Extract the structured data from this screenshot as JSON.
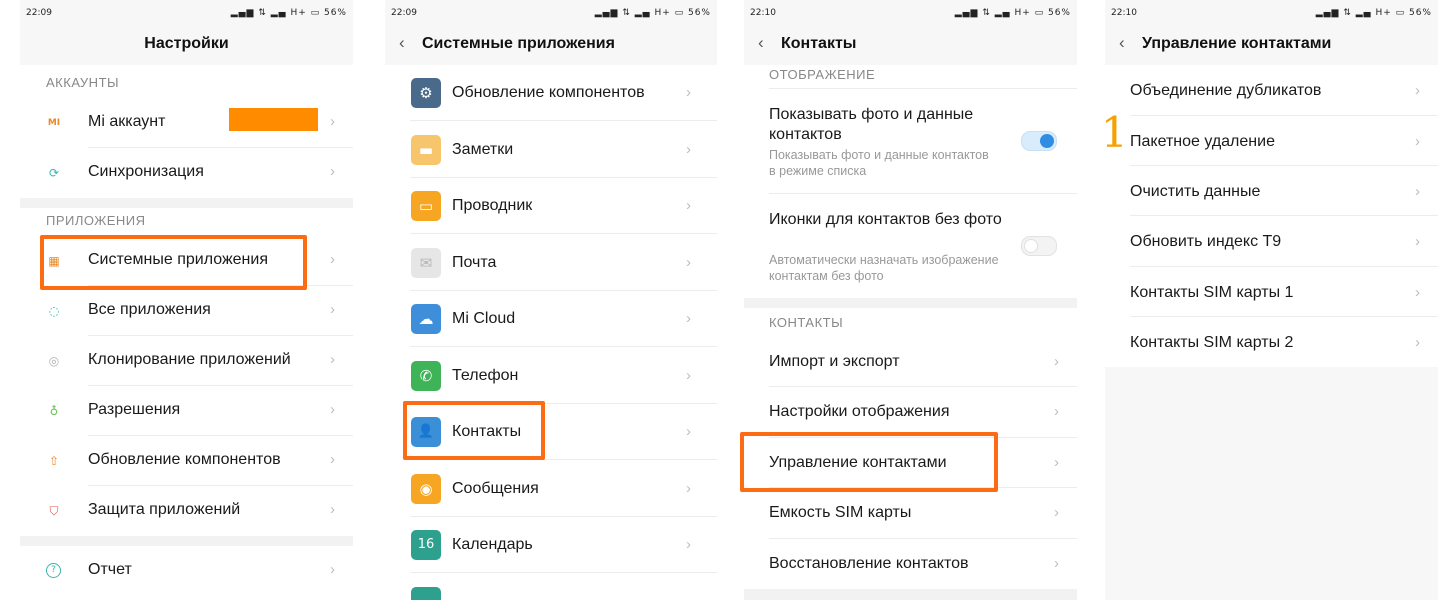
{
  "panel1": {
    "status": {
      "time": "22:09",
      "icons": "▂▄▆ ⇅ ▂▄ H+ ▭ 56%"
    },
    "title": "Настройки",
    "sections": [
      "АККАУНТЫ",
      "ПРИЛОЖЕНИЯ"
    ],
    "items": [
      {
        "label": "Mi аккаунт",
        "icon": "mi-logo-icon",
        "glyph": "MI"
      },
      {
        "label": "Синхронизация",
        "icon": "sync-icon",
        "glyph": "⟳"
      },
      {
        "label": "Системные приложения",
        "icon": "grid-apps-icon",
        "glyph": "▦"
      },
      {
        "label": "Все приложения",
        "icon": "dots-circle-icon",
        "glyph": "◌"
      },
      {
        "label": "Клонирование приложений",
        "icon": "clone-icon",
        "glyph": "◎"
      },
      {
        "label": "Разрешения",
        "icon": "permission-icon",
        "glyph": "♁"
      },
      {
        "label": "Обновление компонентов",
        "icon": "update-icon",
        "glyph": "⇧"
      },
      {
        "label": "Защита приложений",
        "icon": "shield-icon",
        "glyph": "⛉"
      },
      {
        "label": "Отчет",
        "icon": "help-icon",
        "glyph": "?"
      }
    ]
  },
  "panel2": {
    "status": {
      "time": "22:09",
      "icons": "▂▄▆ ⇅ ▂▄ H+ ▭ 56%"
    },
    "title": "Системные приложения",
    "back": "‹",
    "items": [
      {
        "label": "Обновление компонентов",
        "icon": "gear-icon",
        "glyph": "⚙",
        "color": "#4a6a8c"
      },
      {
        "label": "Заметки",
        "icon": "notes-icon",
        "glyph": "▬",
        "color": "#f7c56b"
      },
      {
        "label": "Проводник",
        "icon": "folder-icon",
        "glyph": "▭",
        "color": "#f6a623"
      },
      {
        "label": "Почта",
        "icon": "mail-icon",
        "glyph": "✉",
        "color": "#e6e6e6"
      },
      {
        "label": "Mi Cloud",
        "icon": "cloud-icon",
        "glyph": "☁",
        "color": "#3f8ed9"
      },
      {
        "label": "Телефон",
        "icon": "phone-icon",
        "glyph": "✆",
        "color": "#3fb357"
      },
      {
        "label": "Контакты",
        "icon": "contacts-icon",
        "glyph": "👤",
        "color": "#3a8fd6"
      },
      {
        "label": "Сообщения",
        "icon": "messages-icon",
        "glyph": "◉",
        "color": "#f6a623"
      },
      {
        "label": "Календарь",
        "icon": "calendar-icon",
        "glyph": "16",
        "color": "#2ea08e"
      }
    ]
  },
  "panel3": {
    "status": {
      "time": "22:10",
      "icons": "▂▄▆ ⇅ ▂▄ H+ ▭ 56%"
    },
    "title": "Контакты",
    "back": "‹",
    "sections": [
      "ОТОБРАЖЕНИЕ",
      "КОНТАКТЫ"
    ],
    "toggles": [
      {
        "label": "Показывать фото и данные контактов",
        "sub": "Показывать фото и данные контактов в режиме списка",
        "on": true
      },
      {
        "label": "Иконки для контактов без фото",
        "sub": "Автоматически назначать изображение контактам без фото",
        "on": false
      }
    ],
    "items": [
      {
        "label": "Импорт и экспорт"
      },
      {
        "label": "Настройки отображения"
      },
      {
        "label": "Управление контактами"
      },
      {
        "label": "Емкость SIM карты"
      },
      {
        "label": "Восстановление контактов"
      }
    ]
  },
  "panel4": {
    "status": {
      "time": "22:10",
      "icons": "▂▄▆ ⇅ ▂▄ H+ ▭ 56%"
    },
    "title": "Управление контактами",
    "back": "‹",
    "items": [
      {
        "label": "Объединение дубликатов"
      },
      {
        "label": "Пакетное удаление"
      },
      {
        "label": "Очистить данные"
      },
      {
        "label": "Обновить индекс T9"
      },
      {
        "label": "Контакты SIM карты 1"
      },
      {
        "label": "Контакты SIM карты 2"
      }
    ]
  },
  "chevron": "›",
  "step_number": "1",
  "colors": {
    "highlight": "#fb6c14",
    "step": "#f5a100",
    "toggle_on": "#2f8de4"
  }
}
